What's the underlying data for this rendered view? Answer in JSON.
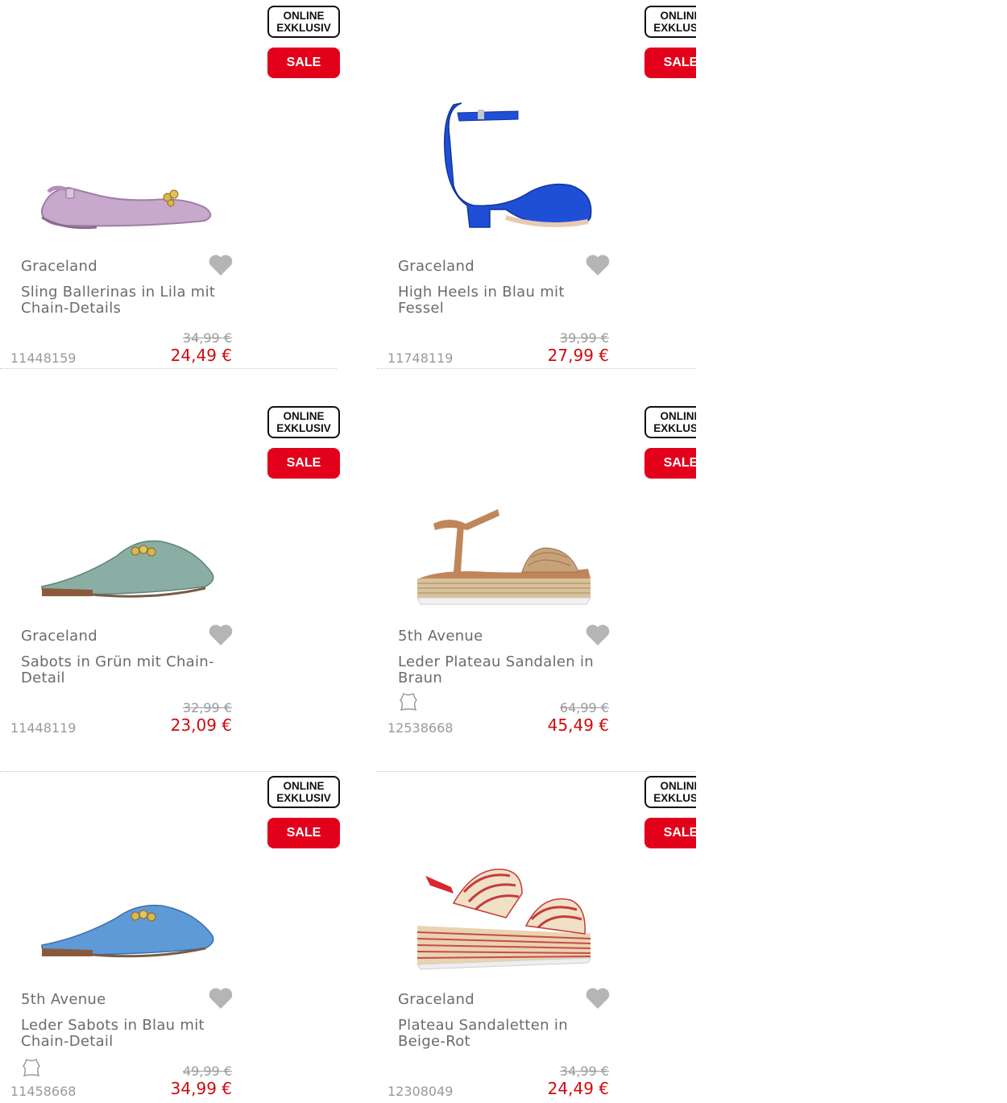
{
  "badges": {
    "online_line1": "ONLINE",
    "online_line2": "EXKLUSIV",
    "sale": "SALE"
  },
  "colors": {
    "sale_red": "#e3001b",
    "price_red": "#d00a10",
    "text_gray": "#6b6b6b",
    "heart_gray": "#b5b5b5"
  },
  "products": [
    {
      "brand": "Graceland",
      "title": "Sling Ballerinas in Lila mit Chain-Details",
      "old_price": "34,99 €",
      "price": "24,49 €",
      "sku": "11448159",
      "leather": false,
      "image": "lilac-slingback-ballerina"
    },
    {
      "brand": "Graceland",
      "title": "High Heels in Blau mit Fessel",
      "old_price": "39,99 €",
      "price": "27,99 €",
      "sku": "11748119",
      "leather": false,
      "image": "blue-block-heel-pump"
    },
    {
      "brand": "Graceland",
      "title": "Sabots in Grün mit Chain-Detail",
      "old_price": "32,99 €",
      "price": "23,09 €",
      "sku": "11448119",
      "leather": false,
      "image": "green-mule-loafer"
    },
    {
      "brand": "5th Avenue",
      "title": "Leder Plateau Sandalen in Braun",
      "old_price": "64,99 €",
      "price": "45,49 €",
      "sku": "12538668",
      "leather": true,
      "image": "brown-espadrille-sandal"
    },
    {
      "brand": "5th Avenue",
      "title": "Leder Sabots in Blau mit Chain-Detail",
      "old_price": "49,99 €",
      "price": "34,99 €",
      "sku": "11458668",
      "leather": true,
      "image": "blue-mule-loafer"
    },
    {
      "brand": "Graceland",
      "title": "Plateau Sandaletten in Beige-Rot",
      "old_price": "34,99 €",
      "price": "24,49 €",
      "sku": "12308049",
      "leather": false,
      "image": "striped-platform-sandal"
    }
  ]
}
